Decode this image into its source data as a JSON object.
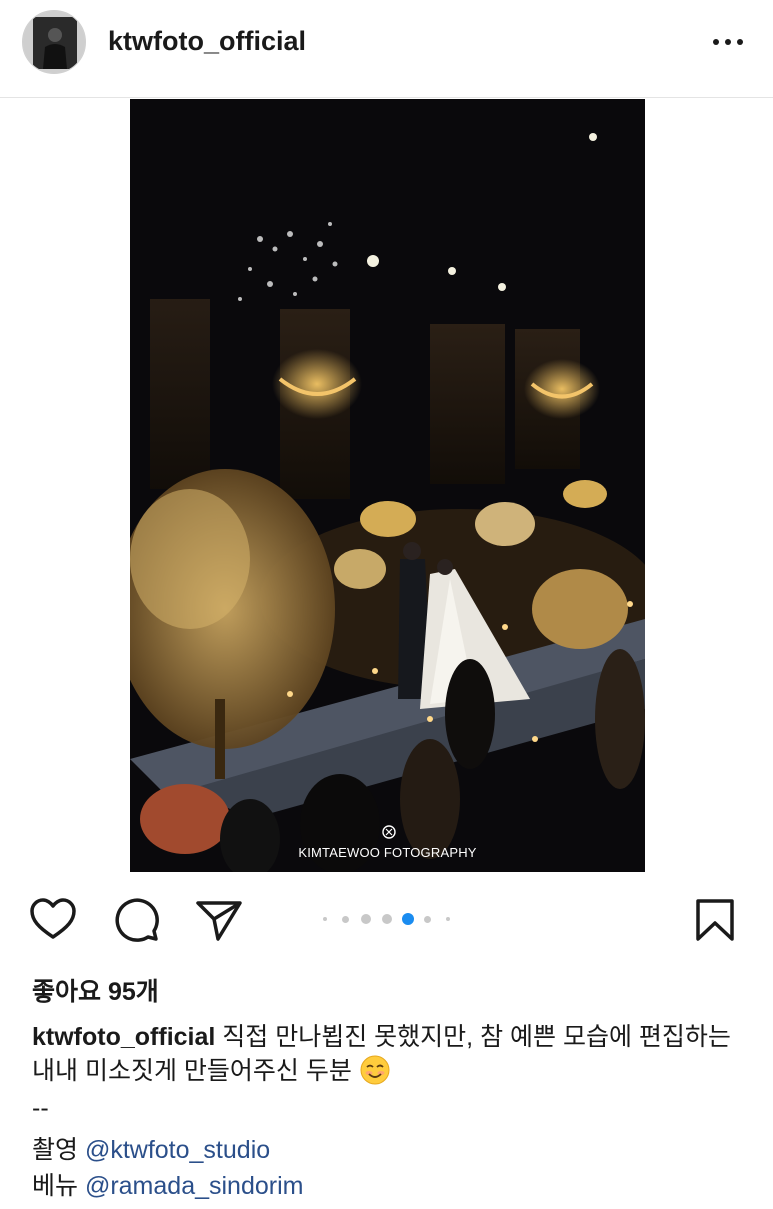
{
  "header": {
    "username": "ktwfoto_official",
    "more_icon": "more-horizontal-icon"
  },
  "photo": {
    "watermark": "KIMTAEWOO FOTOGRAPHY",
    "carousel_total": 7,
    "carousel_active": 5
  },
  "actions": {
    "icons": [
      "heart-icon",
      "comment-icon",
      "share-icon",
      "bookmark-icon"
    ]
  },
  "likes": {
    "text": "좋아요 95개"
  },
  "caption": {
    "user": "ktwfoto_official",
    "text": " 직접 만나뵙진 못했지만, 참 예쁜 모습에 편집하는 내내 미소짓게 만들어주신 두분",
    "emoji": "smiling-face-icon",
    "separator": "--",
    "credit1_label": "촬영 ",
    "credit1_mention": "@ktwfoto_studio",
    "credit2_label": "베뉴 ",
    "credit2_mention": "@ramada_sindorim"
  },
  "colors": {
    "mention": "#2b4f8a",
    "active_dot": "#1a8cf0",
    "text": "#1a1a1a"
  }
}
